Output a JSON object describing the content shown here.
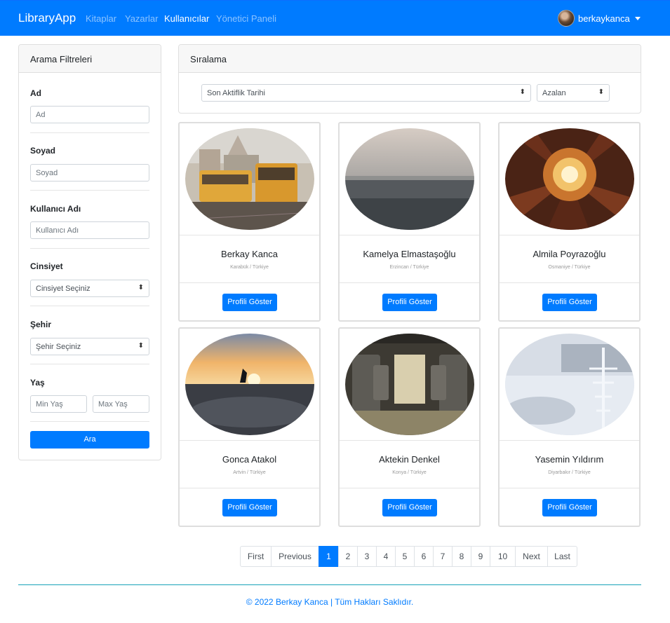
{
  "nav": {
    "brand": "LibraryApp",
    "links": [
      "Kitaplar",
      "Yazarlar",
      "Kullanıcılar",
      "Yönetici Paneli"
    ],
    "username": "berkaykanca"
  },
  "filters": {
    "title": "Arama Filtreleri",
    "name_label": "Ad",
    "name_placeholder": "Ad",
    "surname_label": "Soyad",
    "surname_placeholder": "Soyad",
    "username_label": "Kullanıcı Adı",
    "username_placeholder": "Kullanıcı Adı",
    "gender_label": "Cinsiyet",
    "gender_value": "Cinsiyet Seçiniz",
    "city_label": "Şehir",
    "city_value": "Şehir Seçiniz",
    "age_label": "Yaş",
    "min_age_placeholder": "Min Yaş",
    "max_age_placeholder": "Max Yaş",
    "search_button": "Ara"
  },
  "sorting": {
    "title": "Sıralama",
    "sort_by": "Son Aktiflik Tarihi",
    "order": "Azalan"
  },
  "users": [
    {
      "name": "Berkay Kanca",
      "location": "Karabük / Türkiye",
      "button": "Profili Göster"
    },
    {
      "name": "Kamelya Elmastaşoğlu",
      "location": "Erzincan / Türkiye",
      "button": "Profili Göster"
    },
    {
      "name": "Almila Poyrazoğlu",
      "location": "Osmaniye / Türkiye",
      "button": "Profili Göster"
    },
    {
      "name": "Gonca Atakol",
      "location": "Artvin / Türkiye",
      "button": "Profili Göster"
    },
    {
      "name": "Aktekin Denkel",
      "location": "Konya / Türkiye",
      "button": "Profili Göster"
    },
    {
      "name": "Yasemin Yıldırım",
      "location": "Diyarbakır / Türkiye",
      "button": "Profili Göster"
    }
  ],
  "pagination": {
    "first": "First",
    "previous": "Previous",
    "pages": [
      "1",
      "2",
      "3",
      "4",
      "5",
      "6",
      "7",
      "8",
      "9",
      "10"
    ],
    "next": "Next",
    "last": "Last",
    "active": "1"
  },
  "footer": "© 2022 Berkay Kanca | Tüm Hakları Saklıdır.",
  "colors": {
    "primary": "#007bff",
    "footer_line": "#17a2b8"
  }
}
